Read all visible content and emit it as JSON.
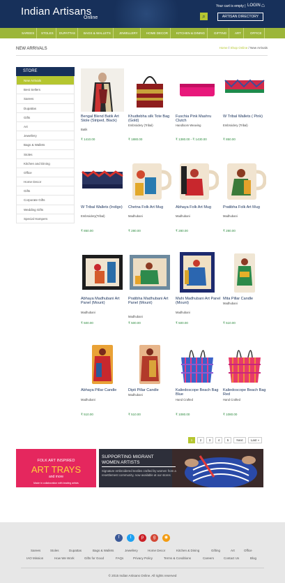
{
  "header": {
    "logo_title": "Indian Artisans",
    "logo_sub": "Online",
    "cart_text": "Your cart is empty |",
    "login": "LOGIN",
    "artisan_directory": "ARTISAN DIRECTORY"
  },
  "nav": [
    "SAREES",
    "STOLES",
    "DUPATTAS",
    "BAGS & WALLETS",
    "JEWELLERY",
    "HOME DECOR",
    "KITCHEN & DINING",
    "GIFTING",
    "ART",
    "OFFICE"
  ],
  "page": {
    "title": "NEW ARRIVALS",
    "breadcrumb_home": "Home",
    "breadcrumb_shop": "Shop Online",
    "breadcrumb_current": "New Arrivals"
  },
  "sidebar": {
    "heading": "STORE",
    "items": [
      "New Arrivals",
      "Best Sellers",
      "Sarees",
      "Dupattas",
      "Gifts",
      "Art",
      "Jewellery",
      "Bags & Wallets",
      "Stoles",
      "Kitchen and Dining",
      "Office",
      "Home Decor",
      "Gifts",
      "Corporate Gifts",
      "Wedding Gifts",
      "Special Hampers"
    ]
  },
  "products": [
    {
      "name": "Bengal Blend Batik Art Stole (Striped, Black)",
      "cat": "Batik",
      "price": "₹ 1410.00"
    },
    {
      "name": "Khudtebha silk Tote Bag (Gold)",
      "cat": "Embroidery (Tribal)",
      "price": "₹ 1880.00"
    },
    {
      "name": "Fuschia Pink Mashru Clutch",
      "cat": "Handloom Weaving",
      "price": "₹ 1380.00 - ₹ 1430.00"
    },
    {
      "name": "W Tribal Wallets ( Pink)",
      "cat": "Embroidery (Tribal)",
      "price": "₹ 850.00"
    },
    {
      "name": "W Tribal Wallets (Indigo)",
      "cat": "Embroidery(Tribal)",
      "price": "₹ 850.00"
    },
    {
      "name": "Chetna Folk Art Mug",
      "cat": "Madhubani",
      "price": "₹ 280.00"
    },
    {
      "name": "Abhaya Folk Art Mug",
      "cat": "Madhubani",
      "price": "₹ 280.00"
    },
    {
      "name": "Pratibha Folk Art Mug",
      "cat": "Madhubani",
      "price": "₹ 280.00"
    },
    {
      "name": "Abhaya Madhubani Art Panel (Mount)",
      "cat": "Madhubani",
      "price": "₹ 500.00"
    },
    {
      "name": "Pratibha Madhubani Art Panel (Mount)",
      "cat": "Madhubani",
      "price": "₹ 500.00"
    },
    {
      "name": "Mahi Madhubani Art Panel (Mount)",
      "cat": "Madhubani",
      "price": "₹ 500.00"
    },
    {
      "name": "Mita Pillar Candle",
      "cat": "Madhubani",
      "price": "₹ 510.00"
    },
    {
      "name": "Abhaya Pillar Candle",
      "cat": "Madhubani",
      "price": "₹ 510.00"
    },
    {
      "name": "Dipti Pillar Candle",
      "cat": "Madhubani",
      "price": "₹ 510.00"
    },
    {
      "name": "Kaliedoscope Beach Bag Blue",
      "cat": "Hand Crafted",
      "price": "₹ 1080.00"
    },
    {
      "name": "Kaliedoscope Beach Bag Red",
      "cat": "Hand Crafted",
      "price": "₹ 1080.00"
    }
  ],
  "pagination": [
    "1",
    "2",
    "3",
    "4",
    "5",
    "Next",
    "Last »"
  ],
  "banner1": {
    "top": "FOLK ART INSPIRED",
    "main": "ART TRAYS",
    "mid": "and more",
    "foot": "Made in collaboration with leading artists"
  },
  "banner2": {
    "title": "SUPPORTING MIGRANT WOMEN ARTISTS",
    "text": "Signature embroidered textiles crafted by women from a resettlement community, now available at our stores"
  },
  "footer": {
    "links1": [
      "Sarees",
      "Stoles",
      "Dupattas",
      "Bags & Wallets",
      "Jewellery",
      "Home Decor",
      "Kitchen & Dining",
      "Gifting",
      "Art",
      "Office"
    ],
    "links2": [
      "IAO Mission",
      "How We Work",
      "Gifts for Good",
      "FAQs",
      "Privacy Policy",
      "Terms & Conditions",
      "Careers",
      "Contact Us",
      "Blog"
    ],
    "copyright": "© 2015 Indian Artisans Online. All rights reserved"
  },
  "colors": {
    "navy": "#17305a",
    "lime": "#9cb63a",
    "price": "#2c8a3e",
    "banner_pink": "#e5275e"
  }
}
